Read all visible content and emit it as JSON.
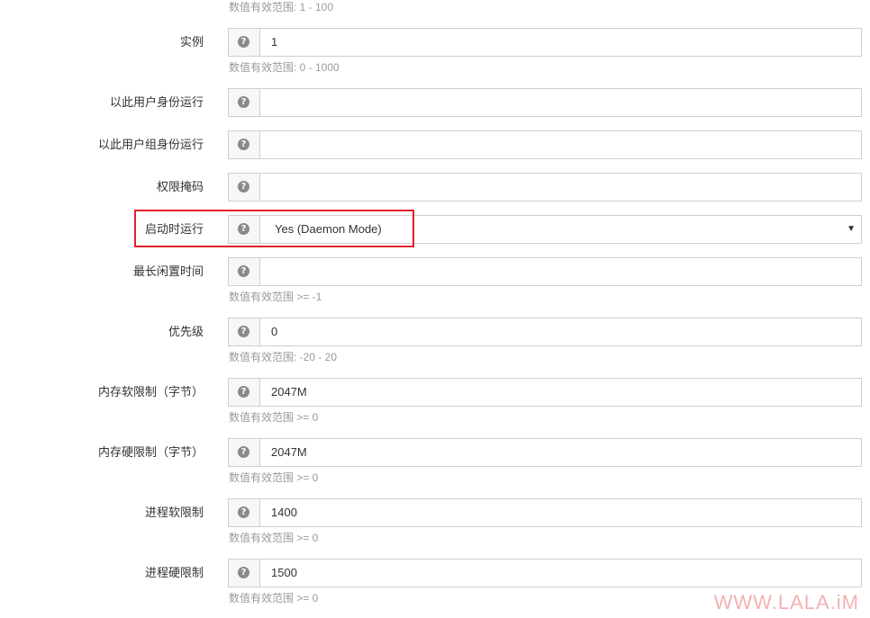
{
  "top_hint": "数值有效范围: 1 - 100",
  "fields": [
    {
      "label": "实例",
      "value": "1",
      "hint": "数值有效范围: 0 - 1000"
    },
    {
      "label": "以此用户身份运行",
      "value": ""
    },
    {
      "label": "以此用户组身份运行",
      "value": ""
    },
    {
      "label": "权限掩码",
      "value": ""
    },
    {
      "label": "启动时运行",
      "value": "Yes (Daemon Mode)",
      "type": "select"
    },
    {
      "label": "最长闲置时间",
      "value": "",
      "hint": "数值有效范围 >= -1"
    },
    {
      "label": "优先级",
      "value": "0",
      "hint": "数值有效范围: -20 - 20"
    },
    {
      "label": "内存软限制（字节）",
      "value": "2047M",
      "hint": "数值有效范围 >= 0"
    },
    {
      "label": "内存硬限制（字节）",
      "value": "2047M",
      "hint": "数值有效范围 >= 0"
    },
    {
      "label": "进程软限制",
      "value": "1400",
      "hint": "数值有效范围 >= 0"
    },
    {
      "label": "进程硬限制",
      "value": "1500",
      "hint": "数值有效范围 >= 0"
    }
  ],
  "help_icon": {
    "name": "question-circle-icon",
    "glyph": "?"
  },
  "caret_icon": {
    "name": "caret-down-icon",
    "glyph": "▼"
  },
  "highlight_color": "#e0202a",
  "watermark": "WWW.LALA.iM"
}
